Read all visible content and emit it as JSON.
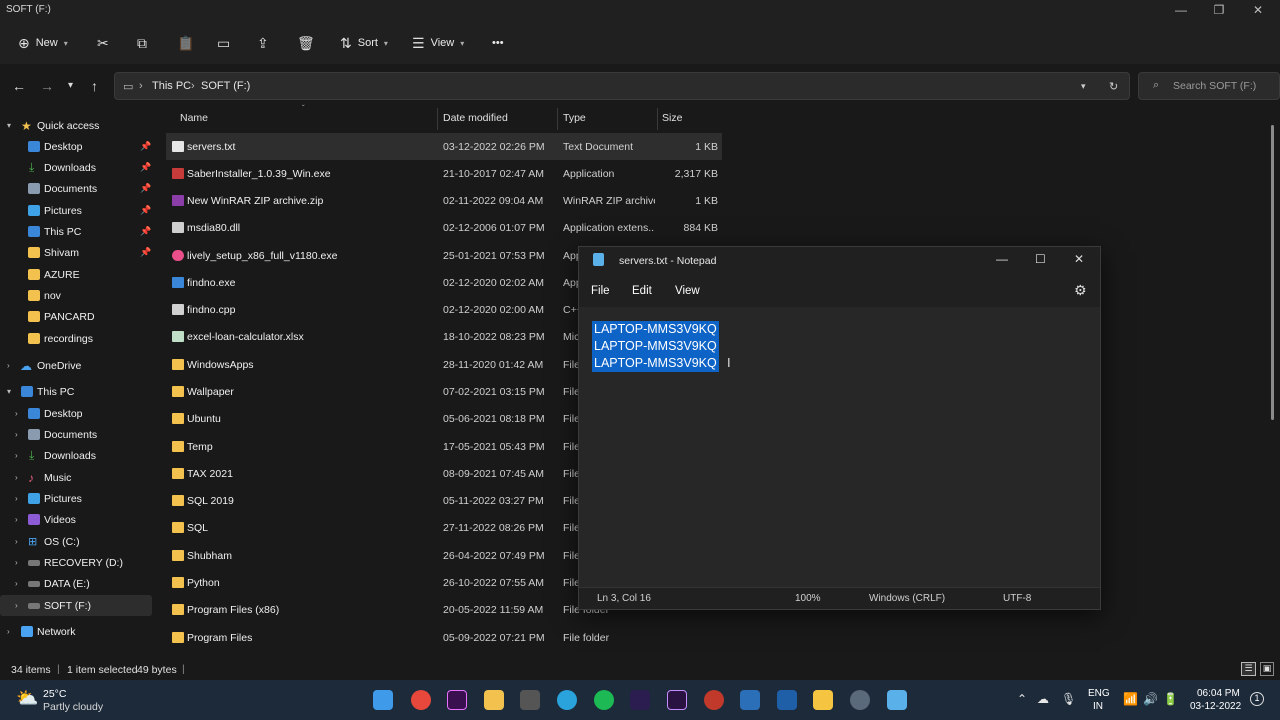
{
  "window": {
    "title": "SOFT (F:)"
  },
  "toolbar": {
    "new_label": "New",
    "sort_label": "Sort",
    "view_label": "View",
    "more_label": "•••"
  },
  "address": {
    "crumbs": [
      "This PC",
      "SOFT (F:)"
    ],
    "search_placeholder": "Search SOFT (F:)"
  },
  "sidebar": {
    "items": [
      {
        "label": "Quick access",
        "icon": "star-icon"
      },
      {
        "label": "Desktop",
        "icon": "desktop-icon",
        "pinned": true
      },
      {
        "label": "Downloads",
        "icon": "download-icon",
        "pinned": true
      },
      {
        "label": "Documents",
        "icon": "document-icon",
        "pinned": true
      },
      {
        "label": "Pictures",
        "icon": "picture-icon",
        "pinned": true
      },
      {
        "label": "This PC",
        "icon": "pc-icon",
        "pinned": true
      },
      {
        "label": "Shivam",
        "icon": "folder-icon",
        "pinned": true
      },
      {
        "label": "AZURE",
        "icon": "folder-icon"
      },
      {
        "label": "nov",
        "icon": "folder-icon"
      },
      {
        "label": "PANCARD",
        "icon": "folder-icon"
      },
      {
        "label": "recordings",
        "icon": "folder-icon"
      },
      {
        "label": "OneDrive",
        "icon": "cloud-icon"
      },
      {
        "label": "This PC",
        "icon": "pc-icon"
      },
      {
        "label": "Desktop",
        "icon": "desktop-icon"
      },
      {
        "label": "Documents",
        "icon": "document-icon"
      },
      {
        "label": "Downloads",
        "icon": "download-icon"
      },
      {
        "label": "Music",
        "icon": "music-icon"
      },
      {
        "label": "Pictures",
        "icon": "picture-icon"
      },
      {
        "label": "Videos",
        "icon": "video-icon"
      },
      {
        "label": "OS (C:)",
        "icon": "drive-icon"
      },
      {
        "label": "RECOVERY (D:)",
        "icon": "drive-icon"
      },
      {
        "label": "DATA (E:)",
        "icon": "drive-icon"
      },
      {
        "label": "SOFT (F:)",
        "icon": "drive-icon"
      },
      {
        "label": "Network",
        "icon": "network-icon"
      }
    ]
  },
  "columns": {
    "name": "Name",
    "date": "Date modified",
    "type": "Type",
    "size": "Size"
  },
  "files": [
    {
      "name": "servers.txt",
      "date": "03-12-2022 02:26 PM",
      "type": "Text Document",
      "size": "1 KB"
    },
    {
      "name": "SaberInstaller_1.0.39_Win.exe",
      "date": "21-10-2017 02:47 AM",
      "type": "Application",
      "size": "2,317 KB"
    },
    {
      "name": "New WinRAR ZIP archive.zip",
      "date": "02-11-2022 09:04 AM",
      "type": "WinRAR ZIP archive",
      "size": "1 KB"
    },
    {
      "name": "msdia80.dll",
      "date": "02-12-2006 01:07 PM",
      "type": "Application extens...",
      "size": "884 KB"
    },
    {
      "name": "lively_setup_x86_full_v1180.exe",
      "date": "25-01-2021 07:53 PM",
      "type": "App",
      "size": ""
    },
    {
      "name": "findno.exe",
      "date": "02-12-2020 02:02 AM",
      "type": "App",
      "size": ""
    },
    {
      "name": "findno.cpp",
      "date": "02-12-2020 02:00 AM",
      "type": "C++",
      "size": ""
    },
    {
      "name": "excel-loan-calculator.xlsx",
      "date": "18-10-2022 08:23 PM",
      "type": "Mic",
      "size": ""
    },
    {
      "name": "WindowsApps",
      "date": "28-11-2020 01:42 AM",
      "type": "File",
      "size": ""
    },
    {
      "name": "Wallpaper",
      "date": "07-02-2021 03:15 PM",
      "type": "File",
      "size": ""
    },
    {
      "name": "Ubuntu",
      "date": "05-06-2021 08:18 PM",
      "type": "File",
      "size": ""
    },
    {
      "name": "Temp",
      "date": "17-05-2021 05:43 PM",
      "type": "File",
      "size": ""
    },
    {
      "name": "TAX 2021",
      "date": "08-09-2021 07:45 AM",
      "type": "File",
      "size": ""
    },
    {
      "name": "SQL 2019",
      "date": "05-11-2022 03:27 PM",
      "type": "File",
      "size": ""
    },
    {
      "name": "SQL",
      "date": "27-11-2022 08:26 PM",
      "type": "File",
      "size": ""
    },
    {
      "name": "Shubham",
      "date": "26-04-2022 07:49 PM",
      "type": "File",
      "size": ""
    },
    {
      "name": "Python",
      "date": "26-10-2022 07:55 AM",
      "type": "File",
      "size": ""
    },
    {
      "name": "Program Files (x86)",
      "date": "20-05-2022 11:59 AM",
      "type": "File folder",
      "size": ""
    },
    {
      "name": "Program Files",
      "date": "05-09-2022 07:21 PM",
      "type": "File folder",
      "size": ""
    }
  ],
  "status": {
    "items": "34 items",
    "selected": "1 item selected",
    "bytes": "49 bytes"
  },
  "notepad": {
    "title": "servers.txt - Notepad",
    "menu": [
      "File",
      "Edit",
      "View"
    ],
    "lines": [
      "LAPTOP-MMS3V9KQ",
      "LAPTOP-MMS3V9KQ",
      "LAPTOP-MMS3V9KQ"
    ],
    "position": "Ln 3, Col 16",
    "zoom": "100%",
    "eol": "Windows (CRLF)",
    "encoding": "UTF-8"
  },
  "taskbar": {
    "weather_temp": "25°C",
    "weather_desc": "Partly cloudy",
    "lang1": "ENG",
    "lang2": "IN",
    "time": "06:04 PM",
    "date": "03-12-2022"
  },
  "colors": {
    "accent": "#0e63c6",
    "folder": "#f2c14e",
    "taskbar": "#1c2a3a"
  }
}
